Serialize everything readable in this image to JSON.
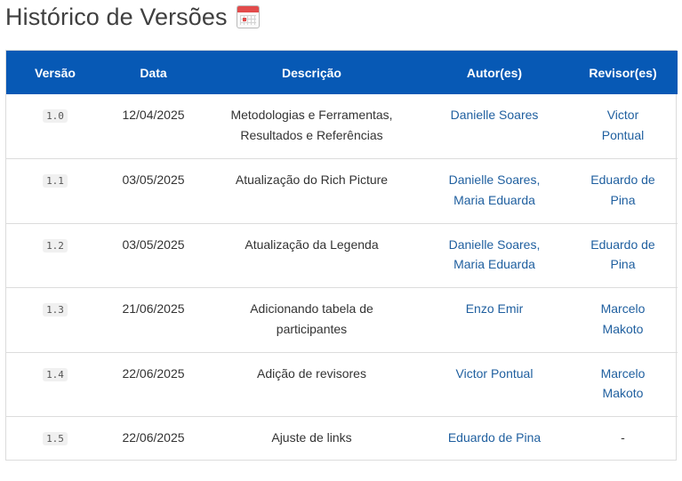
{
  "page": {
    "title": "Histórico de Versões",
    "title_icon": "calendar-icon"
  },
  "table": {
    "header_color": "#0759b5",
    "link_color": "#1f5f9f",
    "headers": {
      "version": "Versão",
      "date": "Data",
      "description": "Descrição",
      "authors": "Autor(es)",
      "reviewers": "Revisor(es)"
    },
    "rows": [
      {
        "version": "1.0",
        "date": "12/04/2025",
        "description": [
          "Metodologias e Ferramentas,",
          "Resultados e Referências"
        ],
        "authors": [
          "Danielle Soares"
        ],
        "reviewers": [
          "Victor",
          "Pontual"
        ]
      },
      {
        "version": "1.1",
        "date": "03/05/2025",
        "description": [
          "Atualização do Rich Picture"
        ],
        "authors": [
          "Danielle Soares,",
          "Maria Eduarda"
        ],
        "reviewers": [
          "Eduardo de",
          "Pina"
        ]
      },
      {
        "version": "1.2",
        "date": "03/05/2025",
        "description": [
          "Atualização da Legenda"
        ],
        "authors": [
          "Danielle Soares,",
          "Maria Eduarda"
        ],
        "reviewers": [
          "Eduardo de",
          "Pina"
        ]
      },
      {
        "version": "1.3",
        "date": "21/06/2025",
        "description": [
          "Adicionando tabela de",
          "participantes"
        ],
        "authors": [
          "Enzo Emir"
        ],
        "reviewers": [
          "Marcelo",
          "Makoto"
        ]
      },
      {
        "version": "1.4",
        "date": "22/06/2025",
        "description": [
          "Adição de revisores"
        ],
        "authors": [
          "Victor Pontual"
        ],
        "reviewers": [
          "Marcelo",
          "Makoto"
        ]
      },
      {
        "version": "1.5",
        "date": "22/06/2025",
        "description": [
          "Ajuste de links"
        ],
        "authors": [
          "Eduardo de Pina"
        ],
        "reviewers": [
          "-"
        ]
      }
    ]
  }
}
